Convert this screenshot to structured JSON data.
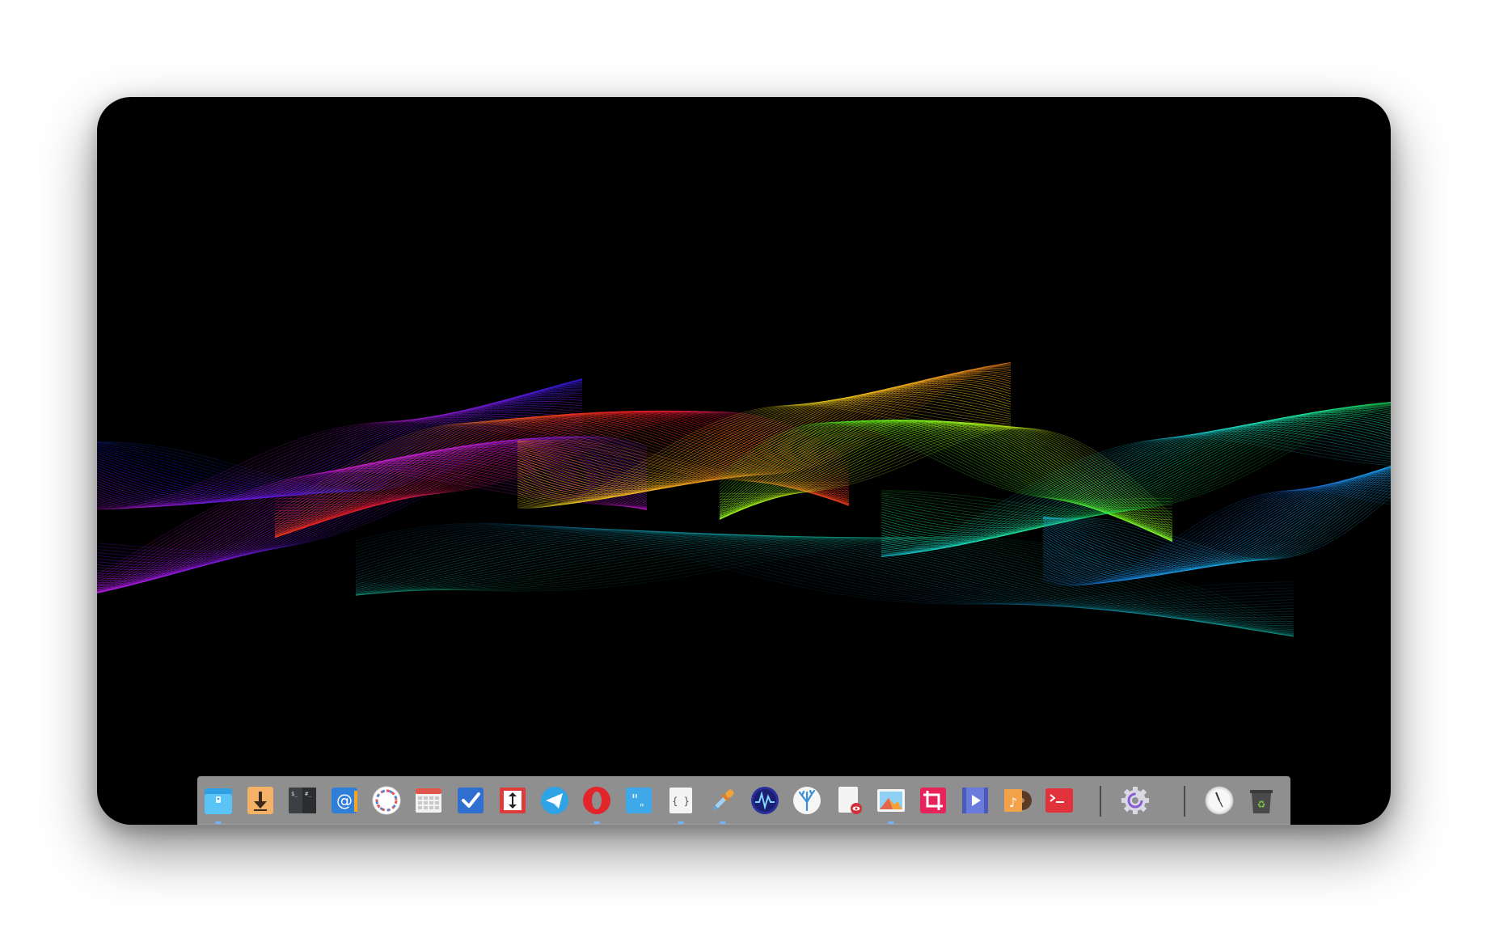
{
  "desktop": {
    "wallpaper": "rainbow-wave-lines",
    "background_color": "#000000",
    "frame_color": "#ffffff"
  },
  "dock": {
    "background_color": "#8f8f8f",
    "items": [
      {
        "name": "file-manager",
        "icon": "folder-icon",
        "running": true
      },
      {
        "name": "downloader",
        "icon": "download-arrow-icon",
        "running": false
      },
      {
        "name": "terminal-multiplexer",
        "icon": "terminal-window-icon",
        "running": false
      },
      {
        "name": "mail",
        "icon": "at-sign-icon",
        "running": false
      },
      {
        "name": "web-browser",
        "icon": "browser-ring-icon",
        "running": false
      },
      {
        "name": "calendar",
        "icon": "calendar-grid-icon",
        "running": false
      },
      {
        "name": "tasks",
        "icon": "checkmark-icon",
        "running": false
      },
      {
        "name": "transfer",
        "icon": "up-down-arrow-icon",
        "running": false
      },
      {
        "name": "telegram",
        "icon": "paper-plane-icon",
        "running": false
      },
      {
        "name": "opera",
        "icon": "opera-o-icon",
        "running": true
      },
      {
        "name": "quotes",
        "icon": "quote-marks-icon",
        "running": false
      },
      {
        "name": "code-editor",
        "icon": "curly-braces-icon",
        "running": true
      },
      {
        "name": "color-picker",
        "icon": "eyedropper-icon",
        "running": true
      },
      {
        "name": "system-monitor",
        "icon": "waveform-icon",
        "running": false
      },
      {
        "name": "coral-app",
        "icon": "coral-icon",
        "running": false
      },
      {
        "name": "document-viewer",
        "icon": "document-eye-icon",
        "running": false
      },
      {
        "name": "image-viewer",
        "icon": "mountain-photo-icon",
        "running": true
      },
      {
        "name": "screenshot-crop",
        "icon": "crop-icon",
        "running": false
      },
      {
        "name": "video-player",
        "icon": "film-play-icon",
        "running": false
      },
      {
        "name": "music-player",
        "icon": "music-note-icon",
        "running": false
      },
      {
        "name": "terminal",
        "icon": "terminal-prompt-icon",
        "running": false
      },
      {
        "name": "settings",
        "icon": "settings-gear-icon",
        "running": false
      },
      {
        "name": "clock",
        "icon": "clock-icon",
        "running": false
      },
      {
        "name": "trash",
        "icon": "recycle-bin-icon",
        "running": false
      }
    ]
  }
}
